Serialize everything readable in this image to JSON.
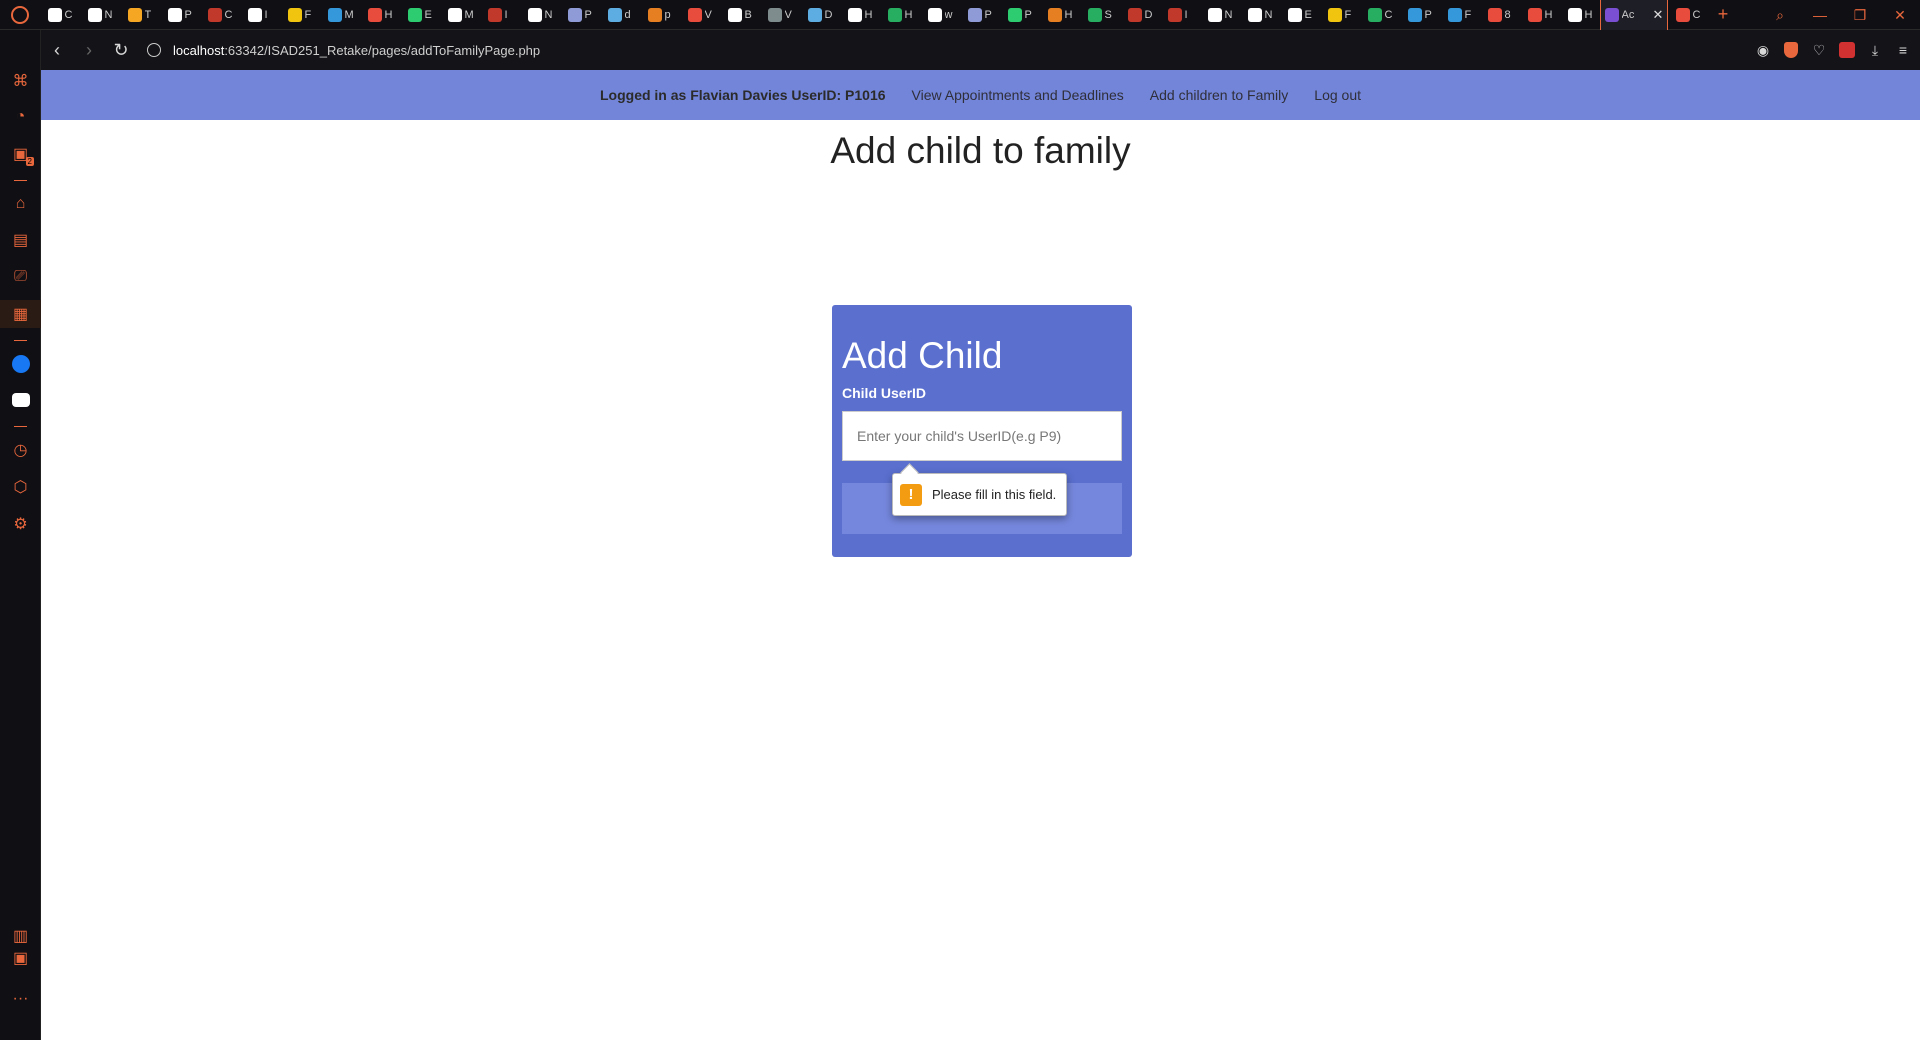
{
  "browser": {
    "tabs": [
      {
        "label": "C",
        "color": "#ffffff"
      },
      {
        "label": "N",
        "color": "#ffffff"
      },
      {
        "label": "T",
        "color": "#f5a623"
      },
      {
        "label": "P",
        "color": "#ffffff"
      },
      {
        "label": "C",
        "color": "#c0392b"
      },
      {
        "label": "I",
        "color": "#ffffff"
      },
      {
        "label": "F",
        "color": "#f1c40f"
      },
      {
        "label": "M",
        "color": "#3498db"
      },
      {
        "label": "H",
        "color": "#e74c3c"
      },
      {
        "label": "E",
        "color": "#2ecc71"
      },
      {
        "label": "M",
        "color": "#ffffff"
      },
      {
        "label": "I",
        "color": "#c0392b"
      },
      {
        "label": "N",
        "color": "#ffffff"
      },
      {
        "label": "P",
        "color": "#8e9bd6"
      },
      {
        "label": "d",
        "color": "#5dade2"
      },
      {
        "label": "p",
        "color": "#e67e22"
      },
      {
        "label": "V",
        "color": "#e74c3c"
      },
      {
        "label": "B",
        "color": "#ffffff"
      },
      {
        "label": "V",
        "color": "#7f8c8d"
      },
      {
        "label": "D",
        "color": "#5dade2"
      },
      {
        "label": "H",
        "color": "#ffffff"
      },
      {
        "label": "H",
        "color": "#27ae60"
      },
      {
        "label": "w",
        "color": "#ffffff"
      },
      {
        "label": "P",
        "color": "#8e9bd6"
      },
      {
        "label": "P",
        "color": "#2ecc71"
      },
      {
        "label": "H",
        "color": "#e67e22"
      },
      {
        "label": "S",
        "color": "#27ae60"
      },
      {
        "label": "D",
        "color": "#c0392b"
      },
      {
        "label": "I",
        "color": "#c0392b"
      },
      {
        "label": "N",
        "color": "#ffffff"
      },
      {
        "label": "N",
        "color": "#ffffff"
      },
      {
        "label": "E",
        "color": "#ffffff"
      },
      {
        "label": "F",
        "color": "#f1c40f"
      },
      {
        "label": "C",
        "color": "#27ae60"
      },
      {
        "label": "P",
        "color": "#3498db"
      },
      {
        "label": "F",
        "color": "#3498db"
      },
      {
        "label": "8",
        "color": "#e74c3c"
      },
      {
        "label": "H",
        "color": "#e74c3c"
      },
      {
        "label": "H",
        "color": "#ffffff"
      }
    ],
    "active_tab": {
      "label": "Ac",
      "color": "#7b4fd1"
    },
    "after_tab": {
      "label": "C",
      "color": "#e74c3c"
    },
    "url_host": "localhost",
    "url_path": ":63342/ISAD251_Retake/pages/addToFamilyPage.php",
    "sidebar_badge": "2"
  },
  "nav": {
    "user_text": "Logged in as Flavian Davies UserID: P1016",
    "links": [
      "View Appointments and Deadlines",
      "Add children to Family",
      "Log out"
    ]
  },
  "page": {
    "heading": "Add child to family"
  },
  "form": {
    "title": "Add Child",
    "field_label": "Child UserID",
    "input_placeholder": "Enter your child's UserID(e.g P9)",
    "input_value": "",
    "submit_label": "Add Child"
  },
  "tooltip": {
    "message": "Please fill in this field."
  },
  "colors": {
    "navbar": "#7385d9",
    "card": "#5a6fce",
    "accent": "#e8673c",
    "warning": "#f39c12"
  }
}
